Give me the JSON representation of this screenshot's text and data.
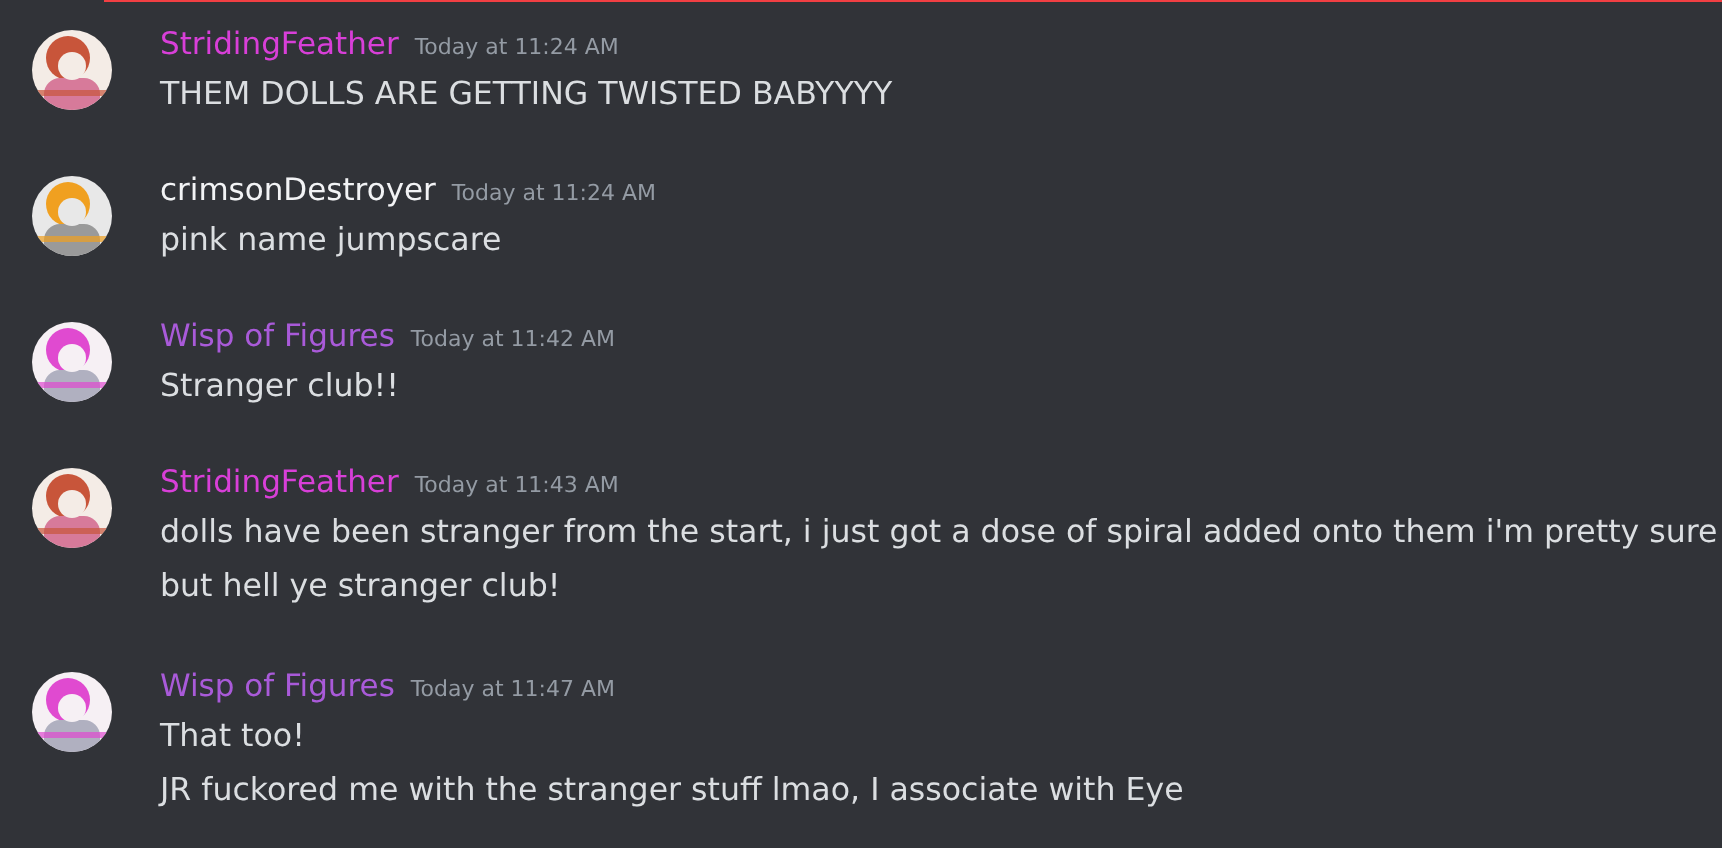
{
  "new_messages_divider": true,
  "messages": [
    {
      "author": "StridingFeather",
      "color": "#d83fd8",
      "time": "Today at 11:24 AM",
      "lines": [
        "THEM DOLLS ARE GETTING TWISTED BABYYYY"
      ]
    },
    {
      "author": "crimsonDestroyer",
      "color": "#f2f3f5",
      "time": "Today at 11:24 AM",
      "lines": [
        "pink name jumpscare"
      ]
    },
    {
      "author": "Wisp of Figures",
      "color": "#a95ad9",
      "time": "Today at 11:42 AM",
      "lines": [
        "Stranger club!!"
      ]
    },
    {
      "author": "StridingFeather",
      "color": "#d83fd8",
      "time": "Today at 11:43 AM",
      "lines": [
        "dolls have been stranger from the start, i just got a dose of spiral added onto them i'm pretty sure",
        "but hell ye stranger club!"
      ]
    },
    {
      "author": "Wisp of Figures",
      "color": "#a95ad9",
      "time": "Today at 11:47 AM",
      "lines": [
        "That too!",
        "JR fuckored me with the stranger stuff lmao, I associate with Eye"
      ]
    }
  ]
}
